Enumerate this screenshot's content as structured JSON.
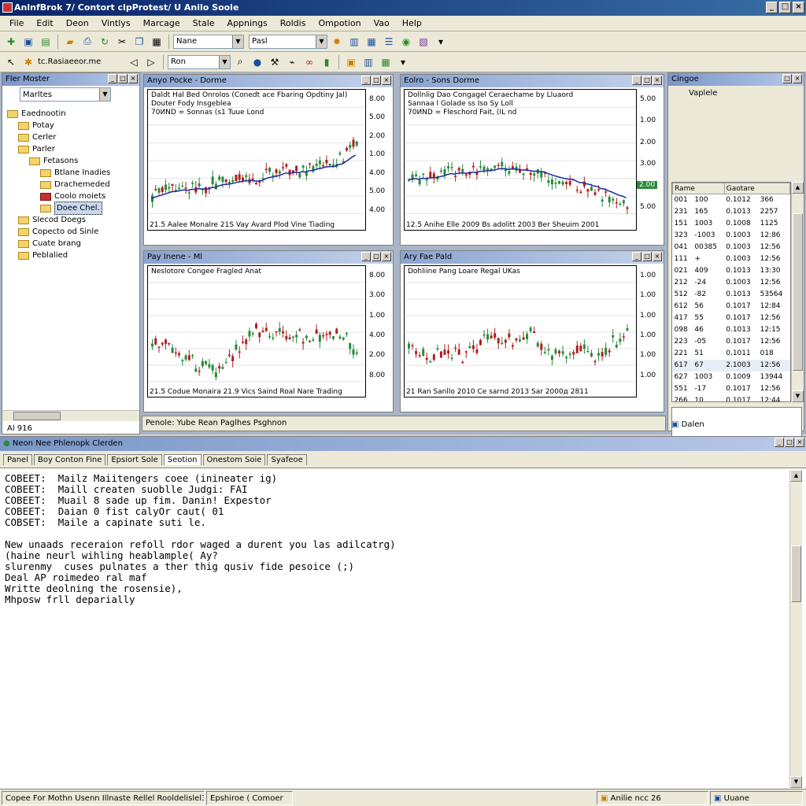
{
  "window": {
    "title": "AnlnfBrok 7/ Contort clpProtest/ U Anilo Soole"
  },
  "menu": [
    "File",
    "Edit",
    "Deon",
    "Vintlys",
    "Marcage",
    "Stale",
    "Appnings",
    "Roldis",
    "Ompotion",
    "Vao",
    "Help"
  ],
  "toolbar1": {
    "combo1": "Nane",
    "combo2": "Pasl"
  },
  "toolbar2": {
    "address": "tc.Rasiaeeor.me",
    "combo": "Ron"
  },
  "file_panel": {
    "title": "Fler Moster",
    "combo": "Marltes",
    "items": [
      {
        "label": "Eaednootin",
        "indent": 0,
        "red": false,
        "sel": false
      },
      {
        "label": "Potay",
        "indent": 1,
        "red": false,
        "sel": false
      },
      {
        "label": "Cerler",
        "indent": 1,
        "red": false,
        "sel": false
      },
      {
        "label": "Parler",
        "indent": 1,
        "red": false,
        "sel": false
      },
      {
        "label": "Fetasons",
        "indent": 2,
        "red": false,
        "sel": false
      },
      {
        "label": "Btlane Inadies",
        "indent": 3,
        "red": false,
        "sel": false
      },
      {
        "label": "Drachemeded",
        "indent": 3,
        "red": false,
        "sel": false
      },
      {
        "label": "Coolo moiets",
        "indent": 3,
        "red": true,
        "sel": false
      },
      {
        "label": "Doee Chel.",
        "indent": 3,
        "red": false,
        "sel": true
      },
      {
        "label": "Slecod Doegs",
        "indent": 1,
        "red": false,
        "sel": false
      },
      {
        "label": "Copecto od Sinle",
        "indent": 1,
        "red": false,
        "sel": false
      },
      {
        "label": "Cuate brang",
        "indent": 1,
        "red": false,
        "sel": false
      },
      {
        "label": "Peblalied",
        "indent": 1,
        "red": false,
        "sel": false
      }
    ],
    "status": "Al 916"
  },
  "charts": [
    {
      "header": "Anyo Pocke - Dorme",
      "title_lines": [
        "Daldt Hal Bed Onrolos (Conedt ace Fbaring Opdtiny Jal)",
        "Douter Fody Insgeblea",
        "70ИND = Sonnas (s1  Tuue Lond"
      ],
      "yticks": [
        "8.00",
        "5.00",
        "2.00",
        "1.00",
        "4.00",
        "5.00",
        "4.00"
      ],
      "xlabels": "21.5  Aalee  Monalre 21S  Vay   Avard Plod  Vine  Tiading"
    },
    {
      "header": "Eolro - Sons Dorme",
      "title_lines": [
        "Dollnlig Dao  Congagel  Ceraechame by  Lluaord",
        "Sannaa l Golade  ss   Iso  Sy  Loll",
        "70ИND = Fleschord  Fait, (IL nd"
      ],
      "yticks": [
        "5.00",
        "1.00",
        "2.00",
        "3.00",
        "4.00",
        "5.00"
      ],
      "xlabels": "12.5 Anihe  Elle  2009  Bs adolitt  2003   Ber Sheuim 2001",
      "side_badge": "2.00"
    },
    {
      "header": "Pay Inene - Ml",
      "title_lines": [
        "Neslotore  Congee  Fragled  Anat"
      ],
      "yticks": [
        "8.00",
        "3.00",
        "1.00",
        "4.00",
        "2.00",
        "8.00"
      ],
      "xlabels": "21.5  Codue  Monaira  21.9  Vics  Saind  Roal  Nare  Trading"
    },
    {
      "header": "Ary Fae Pald",
      "title_lines": [
        "Dohliine  Pang  Loare  Regal  UKas"
      ],
      "yticks": [
        "1.00",
        "1.00",
        "1.00",
        "1.00",
        "1.00",
        "1.00"
      ],
      "xlabels": "21 Ran     Sanllo    2010   Ce sarnd     2013   Sar 2000д  2811"
    }
  ],
  "chart_status": "Penole:   Yube    Rean Paglhes   Psghnon",
  "quotes_panel": {
    "title": "Cingoe",
    "subtitle": "Vaplele",
    "headers": [
      "Rame",
      "Gaotare"
    ],
    "rows": [
      [
        "001",
        "100",
        "0.1012",
        "366"
      ],
      [
        "231",
        "165",
        "0.1013",
        "2257"
      ],
      [
        "151",
        "1003",
        "0.1008",
        "1125"
      ],
      [
        "323",
        "-1003",
        "0.1003",
        "12:86"
      ],
      [
        "041",
        "00385",
        "0.1003",
        "12:56"
      ],
      [
        "111",
        "+",
        "0.1003",
        "12:56"
      ],
      [
        "021",
        "409",
        "0.1013",
        "13:30"
      ],
      [
        "212",
        "-24",
        "0.1003",
        "12:56"
      ],
      [
        "512",
        "-82",
        "0.1013",
        "53564"
      ],
      [
        "612",
        "56",
        "0.1017",
        "12:84"
      ],
      [
        "417",
        "55",
        "0.1017",
        "12:56"
      ],
      [
        "098",
        "46",
        "0.1013",
        "12:15"
      ],
      [
        "223",
        "-05",
        "0.1017",
        "12:56"
      ],
      [
        "221",
        "51",
        "0.1011",
        "018"
      ],
      [
        "617",
        "67",
        "2.1003",
        "12:56"
      ],
      [
        "627",
        "1003",
        "0.1009",
        "13944"
      ],
      [
        "551",
        "-17",
        "0.1017",
        "12:56"
      ],
      [
        "266",
        "10",
        "0.1017",
        "12:44"
      ]
    ],
    "footer": "Dalen"
  },
  "output_panel": {
    "title": "Neon Nee Phlenopk Clerden",
    "tabs": [
      "Panel",
      "Boy Conton Fine",
      "Epsiort Sole",
      "Seotion",
      "Onestom Soie",
      "Syafeoe"
    ],
    "active_tab": 3,
    "lines": [
      "COBEET:  Mailz Maiitengers coee (inineater ig)",
      "COBEET:  Maill createn suoblle Judgi: FAI",
      "COBEET:  Muail 8 sade up fim. Danin! Expestor",
      "COBEET:  Daian 0 fist calyOr caut( 01",
      "COBSET:  Maile a capinate suti le.",
      "",
      "New unaads receraion refoll rdor waged a durent you las adilcatrg)",
      "(haine neurl wihling heablample( Ay?",
      "slurenmy  cuses pulnates a ther thig qusiv fide pesoice (;)",
      "Deal AP roimedeo ral maf",
      "Writte deolning the rosensie),",
      "Mhposw frll deparially"
    ]
  },
  "statusbar": {
    "left": "Copee For Mothn Usenn Illnaste Rellel Rooldelislel3",
    "mid": "Epshiroe ( Comoer",
    "right1": "Anilie    ncc 26",
    "right2": "Uuane"
  },
  "colors": {
    "up": "#2a8a3a",
    "down": "#b02020",
    "ma": "#1a2aa0",
    "titlebar": "#0a246a"
  }
}
